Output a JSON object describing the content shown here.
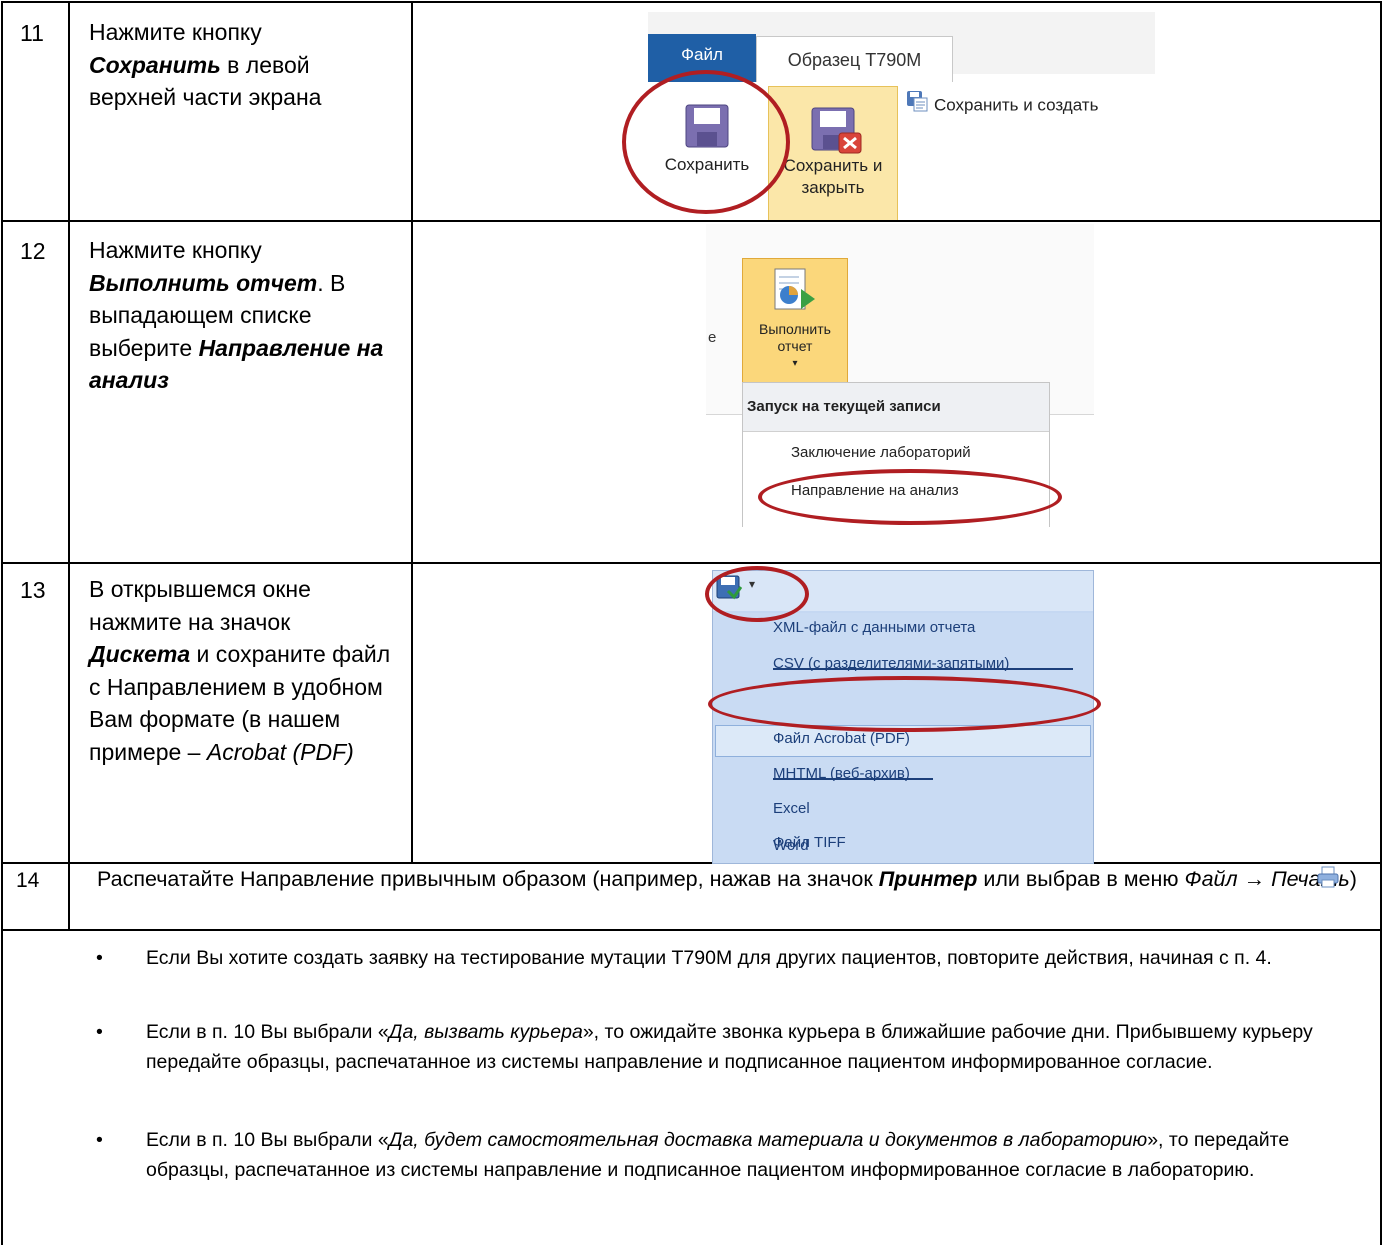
{
  "rows": [
    {
      "num": "11",
      "parts": [
        {
          "t": "Нажмите кнопку "
        },
        {
          "t": "Сохранить",
          "s": "bi"
        },
        {
          "t": " в левой верхней части экрана"
        }
      ]
    },
    {
      "num": "12",
      "parts": [
        {
          "t": "Нажмите кнопку "
        },
        {
          "t": "Выполнить отчет",
          "s": "bi"
        },
        {
          "t": ". В выпадающем списке выберите "
        },
        {
          "t": "Направление на анализ",
          "s": "bi"
        }
      ]
    },
    {
      "num": "13",
      "parts": [
        {
          "t": "В открывшемся окне нажмите на значок "
        },
        {
          "t": "Дискета",
          "s": "bi"
        },
        {
          "t": " и сохраните файл с Направлением в удобном Вам формате (в нашем примере – "
        },
        {
          "t": "Acrobat (PDF)",
          "s": "i"
        }
      ]
    },
    {
      "num": "14",
      "parts": [
        {
          "t": "Распечатайте Направление привычным образом (например, нажав на значок "
        },
        {
          "t": "Принтер",
          "s": "bi"
        },
        {
          "t": " "
        },
        {
          "t": "или выбрав в меню "
        },
        {
          "t": "Файл → Печать",
          "s": "i"
        },
        {
          "t": ")"
        }
      ]
    }
  ],
  "ribbon1": {
    "file_tab": "Файл",
    "doc_tab": "Образец T790M",
    "save": "Сохранить",
    "save_close": "Сохранить и закрыть",
    "save_create": "Сохранить и создать"
  },
  "ribbon2": {
    "edge_text": "е",
    "run_report": "Выполнить отчет",
    "menu_header": "Запуск на текущей записи",
    "menu_items": [
      "Заключение лабораторий",
      "Направление на анализ"
    ]
  },
  "export_menu": {
    "items": [
      "XML-файл с данными отчета",
      "CSV (с разделителями-запятыми)",
      "Файл Acrobat (PDF)",
      "MHTML (веб-архив)",
      "Excel",
      "Файл TIFF",
      "Word"
    ]
  },
  "notes": [
    [
      {
        "t": "Если Вы хотите создать заявку на тестирование мутации Т790М для других пациентов, повторите действия, начиная с п. 4."
      }
    ],
    [
      {
        "t": "Если в п. 10 Вы выбрали «"
      },
      {
        "t": "Да, вызвать курьера",
        "s": "i"
      },
      {
        "t": "», то ожидайте звонка курьера в ближайшие рабочие дни. Прибывшему курьеру передайте образцы, распечатанное из системы направление и подписанное пациентом информированное согласие."
      }
    ],
    [
      {
        "t": "Если в п. 10 Вы выбрали «"
      },
      {
        "t": "Да, будет самостоятельная доставка материала и документов в лабораторию",
        "s": "i"
      },
      {
        "t": "», то передайте образцы, распечатанное из системы направление и подписанное пациентом информированное согласие в лабораторию."
      }
    ]
  ],
  "colors": {
    "highlight": "#b01e22",
    "file_tab": "#1f5fa6",
    "menu_blue": "#c5d8f2"
  }
}
